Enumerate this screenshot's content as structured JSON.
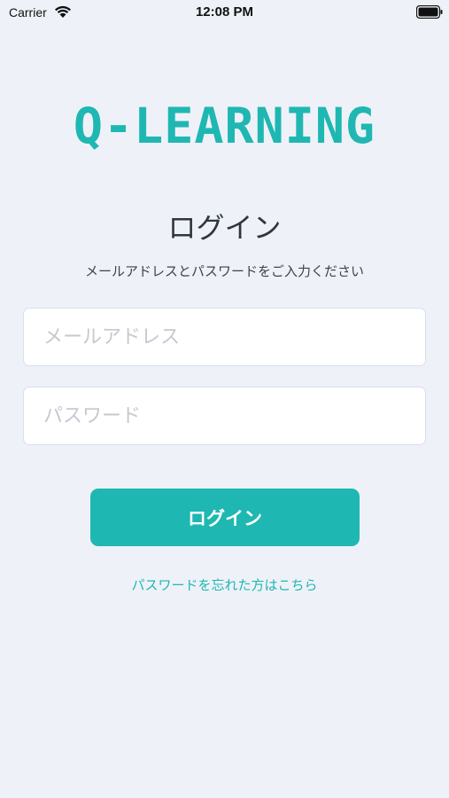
{
  "status_bar": {
    "carrier": "Carrier",
    "time": "12:08 PM",
    "wifi_icon": "wifi-icon",
    "battery_icon": "battery-icon"
  },
  "logo": {
    "text": "Q-LEARNING",
    "color": "#1fb7b2"
  },
  "login": {
    "title": "ログイン",
    "subtitle": "メールアドレスとパスワードをご入力ください",
    "email_value": "",
    "email_placeholder": "メールアドレス",
    "password_value": "",
    "password_placeholder": "パスワード",
    "button_label": "ログイン",
    "forgot_password_link": "パスワードを忘れた方はこちら"
  },
  "colors": {
    "accent": "#1fb7b2",
    "background": "#eef2f8"
  }
}
